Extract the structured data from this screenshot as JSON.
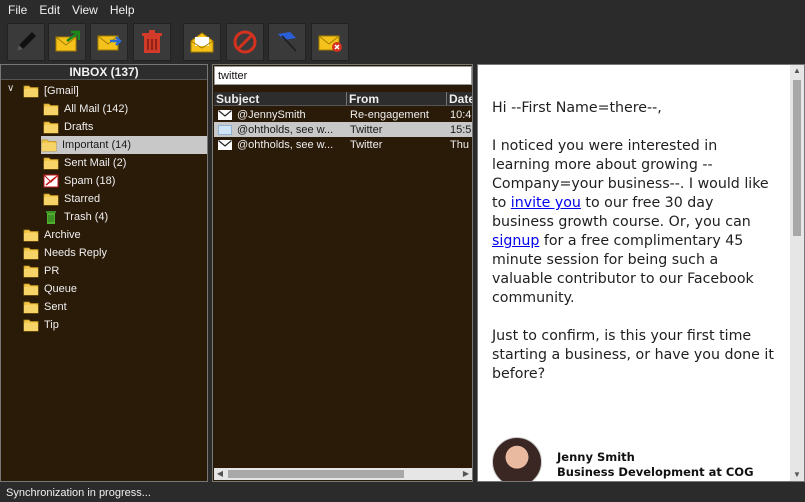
{
  "menu": [
    "File",
    "Edit",
    "View",
    "Help"
  ],
  "toolbar": [
    {
      "name": "compose-button",
      "icon": "pencil-icon"
    },
    {
      "name": "send-receive-button",
      "icon": "envelope-up-icon"
    },
    {
      "name": "forward-button",
      "icon": "envelope-forward-icon"
    },
    {
      "name": "delete-button",
      "icon": "trash-icon"
    },
    {
      "name": "mark-read-button",
      "icon": "open-envelope-icon"
    },
    {
      "name": "block-button",
      "icon": "prohibited-icon"
    },
    {
      "name": "flag-button",
      "icon": "flag-icon"
    },
    {
      "name": "mark-spam-button",
      "icon": "envelope-x-icon"
    }
  ],
  "folders": {
    "header": "INBOX (137)",
    "items": [
      {
        "label": "[Gmail]",
        "icon": "folder-icon"
      },
      {
        "label": "All Mail (142)",
        "icon": "folder-icon"
      },
      {
        "label": "Drafts",
        "icon": "folder-icon"
      },
      {
        "label": "Important (14)",
        "icon": "folder-icon",
        "selected": true
      },
      {
        "label": "Sent Mail (2)",
        "icon": "folder-icon"
      },
      {
        "label": "Spam (18)",
        "icon": "spam-icon"
      },
      {
        "label": "Starred",
        "icon": "folder-icon"
      },
      {
        "label": "Trash (4)",
        "icon": "trash-icon"
      },
      {
        "label": "Archive",
        "icon": "folder-icon"
      },
      {
        "label": "Needs Reply",
        "icon": "folder-icon"
      },
      {
        "label": "PR",
        "icon": "folder-icon"
      },
      {
        "label": "Queue",
        "icon": "folder-icon"
      },
      {
        "label": "Sent",
        "icon": "folder-icon"
      },
      {
        "label": "Tip",
        "icon": "folder-icon"
      }
    ]
  },
  "messages": {
    "search_value": "twitter",
    "columns": [
      "Subject",
      "From",
      "Date"
    ],
    "rows": [
      {
        "subject": "@JennySmith",
        "from": "Re-engagement",
        "date": "10:4"
      },
      {
        "subject": "@ohtholds, see w...",
        "from": "Twitter",
        "date": "15:5",
        "selected": true
      },
      {
        "subject": "@ohtholds, see w...",
        "from": "Twitter",
        "date": "Thu"
      }
    ]
  },
  "preview": {
    "greeting": "Hi --First Name=there--,",
    "p1_a": "I noticed you were interested in learning more about growing --Company=your business--. I would like to ",
    "p1_link1": "invite you",
    "p1_b": " to our free 30 day business growth course. Or, you can ",
    "p1_link2": "signup",
    "p1_c": " for a free complimentary 45 minute session for being such a valuable contributor to our Facebook community.",
    "p2": "Just to confirm, is this your first time starting a business, or have you done it before?",
    "sig_name": "Jenny Smith",
    "sig_title": "Business Development at COG"
  },
  "status": "Synchronization in progress..."
}
